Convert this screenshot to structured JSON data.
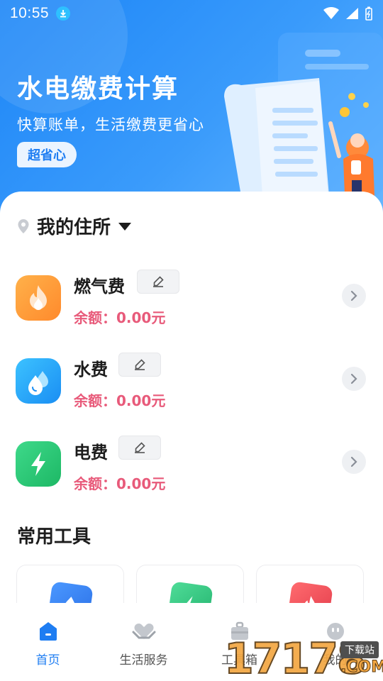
{
  "status_bar": {
    "time": "10:55"
  },
  "hero": {
    "title": "水电缴费计算",
    "subtitle": "快算账单，生活缴费更省心",
    "badge": "超省心"
  },
  "residence": {
    "label": "我的住所"
  },
  "bills": [
    {
      "name": "燃气费",
      "balance": "余额：0.00元",
      "icon": "flame-icon",
      "color": "#ff9a3c"
    },
    {
      "name": "水费",
      "balance": "余额：0.00元",
      "icon": "water-drop-icon",
      "color": "#1ea7f5"
    },
    {
      "name": "电费",
      "balance": "余额：0.00元",
      "icon": "lightning-icon",
      "color": "#25c66f"
    }
  ],
  "tools_section": {
    "title": "常用工具"
  },
  "tools": [
    {
      "icon": "water-tool-icon",
      "color": "#2d7ff0"
    },
    {
      "icon": "electric-tool-icon",
      "color": "#2cc37a"
    },
    {
      "icon": "gas-tool-icon",
      "color": "#f0505a"
    }
  ],
  "bottom_nav": [
    {
      "label": "首页",
      "icon": "home-icon",
      "active": true
    },
    {
      "label": "生活服务",
      "icon": "heart-hands-icon",
      "active": false
    },
    {
      "label": "工具箱",
      "icon": "toolbox-icon",
      "active": false
    },
    {
      "label": "我的",
      "icon": "profile-icon",
      "active": false
    }
  ],
  "watermark": {
    "digits": "17178",
    "tag": "下载站",
    "domain": ".COM"
  },
  "colors": {
    "accent": "#1e7df2",
    "balance": "#e85a7a",
    "hero_start": "#1d86f7",
    "hero_end": "#64b6ff"
  }
}
